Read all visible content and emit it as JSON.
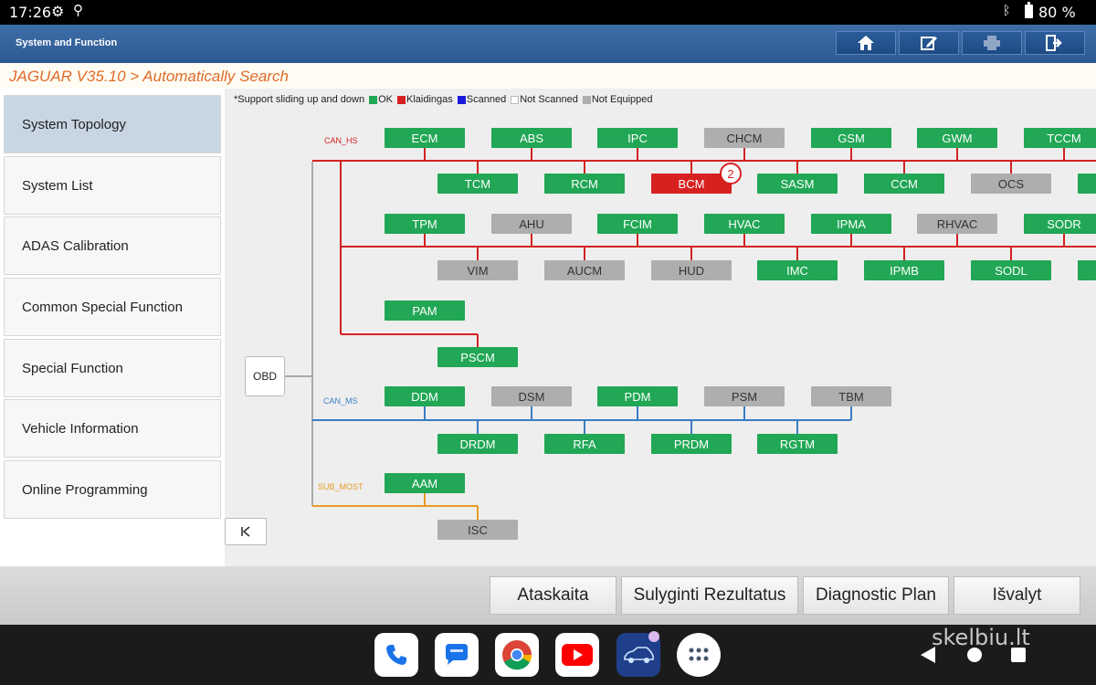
{
  "status_bar": {
    "time": "17:26",
    "battery": "80 %"
  },
  "header": {
    "title": "System and Function"
  },
  "breadcrumb": "JAGUAR V35.10 > Automatically Search",
  "sidebar": {
    "items": [
      {
        "label": "System Topology",
        "active": true
      },
      {
        "label": "System List"
      },
      {
        "label": "ADAS Calibration"
      },
      {
        "label": "Common Special Function"
      },
      {
        "label": "Special Function"
      },
      {
        "label": "Vehicle Information"
      },
      {
        "label": "Online Programming"
      }
    ]
  },
  "legend": {
    "note": "*Support sliding up and down",
    "items": [
      {
        "label": "OK",
        "color": "#21a755"
      },
      {
        "label": "Klaidingas",
        "color": "#d72121"
      },
      {
        "label": "Scanned",
        "color": "#1a1adc"
      },
      {
        "label": "Not Scanned",
        "color": "#ffffff"
      },
      {
        "label": "Not Equipped",
        "color": "#aeaeae"
      }
    ]
  },
  "topology": {
    "obd_label": "OBD",
    "buses": [
      {
        "name": "CAN_HS",
        "color": "#d32222"
      },
      {
        "name": "CAN_MS",
        "color": "#3a7cc4"
      },
      {
        "name": "SUB_MOST",
        "color": "#e79b22"
      }
    ],
    "modules": [
      {
        "name": "ECM",
        "status": "ok"
      },
      {
        "name": "ABS",
        "status": "ok"
      },
      {
        "name": "IPC",
        "status": "ok"
      },
      {
        "name": "CHCM",
        "status": "ne"
      },
      {
        "name": "GSM",
        "status": "ok"
      },
      {
        "name": "GWM",
        "status": "ok"
      },
      {
        "name": "TCCM",
        "status": "ok"
      },
      {
        "name": "TCM",
        "status": "ok"
      },
      {
        "name": "RCM",
        "status": "ok"
      },
      {
        "name": "BCM",
        "status": "err",
        "badge": "2"
      },
      {
        "name": "SASM",
        "status": "ok"
      },
      {
        "name": "CCM",
        "status": "ok"
      },
      {
        "name": "OCS",
        "status": "ne"
      },
      {
        "name": "TPM",
        "status": "ok"
      },
      {
        "name": "AHU",
        "status": "ne"
      },
      {
        "name": "FCIM",
        "status": "ok"
      },
      {
        "name": "HVAC",
        "status": "ok"
      },
      {
        "name": "IPMA",
        "status": "ok"
      },
      {
        "name": "RHVAC",
        "status": "ne"
      },
      {
        "name": "SODR",
        "status": "ok"
      },
      {
        "name": "VIM",
        "status": "ne"
      },
      {
        "name": "AUCM",
        "status": "ne"
      },
      {
        "name": "HUD",
        "status": "ne"
      },
      {
        "name": "IMC",
        "status": "ok"
      },
      {
        "name": "IPMB",
        "status": "ok"
      },
      {
        "name": "SODL",
        "status": "ok"
      },
      {
        "name": "PAM",
        "status": "ok"
      },
      {
        "name": "PSCM",
        "status": "ok"
      },
      {
        "name": "DDM",
        "status": "ok"
      },
      {
        "name": "DSM",
        "status": "ne"
      },
      {
        "name": "PDM",
        "status": "ok"
      },
      {
        "name": "PSM",
        "status": "ne"
      },
      {
        "name": "TBM",
        "status": "ne"
      },
      {
        "name": "DRDM",
        "status": "ok"
      },
      {
        "name": "RFA",
        "status": "ok"
      },
      {
        "name": "PRDM",
        "status": "ok"
      },
      {
        "name": "RGTM",
        "status": "ok"
      },
      {
        "name": "AAM",
        "status": "ok"
      },
      {
        "name": "ISC",
        "status": "ne"
      }
    ]
  },
  "actions": {
    "report": "Ataskaita",
    "compare": "Sulyginti Rezultatus",
    "plan": "Diagnostic Plan",
    "clear": "Išvalyt"
  },
  "watermark": "skelbiu.lt",
  "colors": {
    "header": "#2c5a92",
    "ok": "#21a755",
    "error": "#d72121",
    "not_equipped": "#aeaeae"
  }
}
